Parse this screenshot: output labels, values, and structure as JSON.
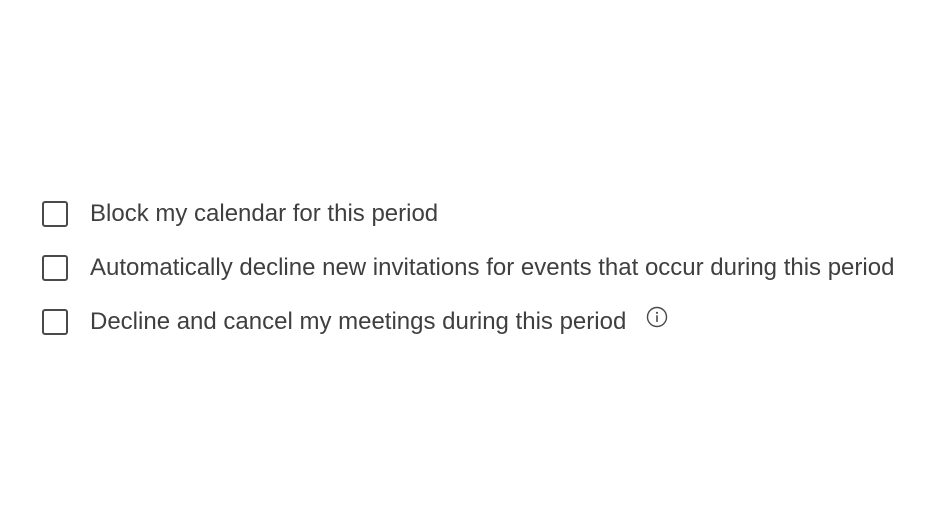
{
  "options": [
    {
      "label": "Block my calendar for this period",
      "checked": false
    },
    {
      "label": "Automatically decline new invitations for events that occur during this period",
      "checked": false
    },
    {
      "label": "Decline and cancel my meetings during this period",
      "checked": false,
      "info_icon": "info-icon"
    }
  ]
}
